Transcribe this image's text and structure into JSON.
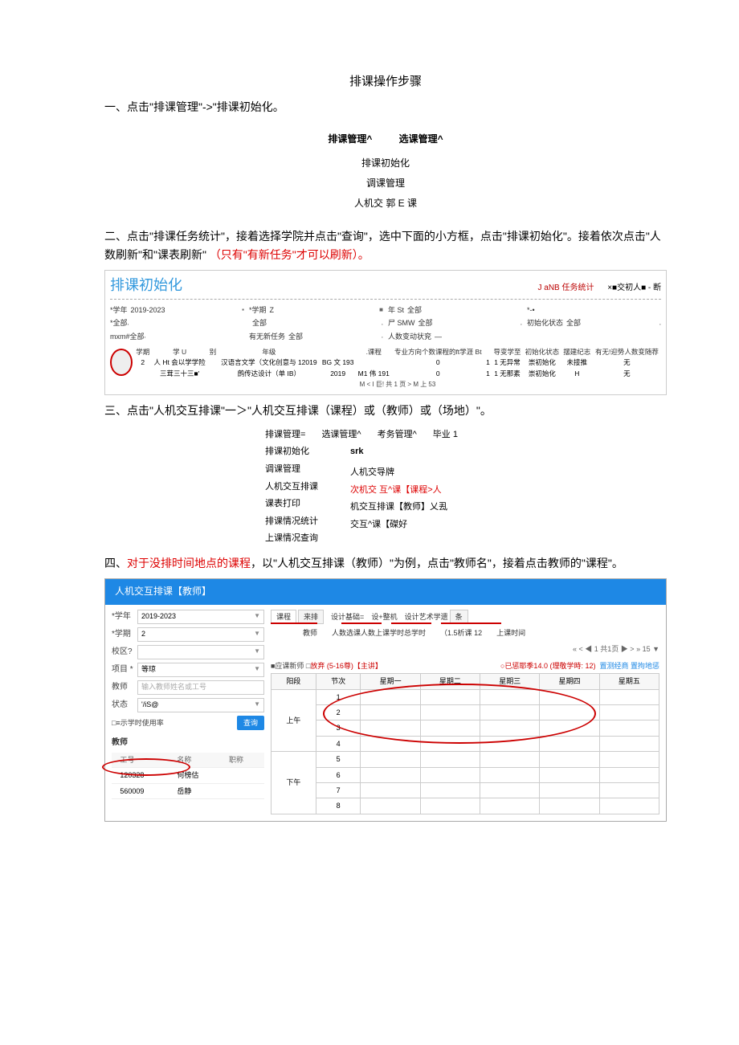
{
  "title": "排课操作步骤",
  "step1": "一、点击\"排课管理\"->\"排课初始化。",
  "menu1_top": [
    "排课管理^",
    "选课管理^"
  ],
  "menu1_items": [
    "排课初始化",
    "调课管理",
    "人机交 郭 E 课"
  ],
  "step2_a": "二、点击\"排课任务统计\"，接着选择学院并点击\"查询\"，选中下面的小方框，点击\"排课初始化\"。接着依次点击\"人数刷新\"和\"课表刷新\"",
  "step2_b": "（只有\"有新任务\"才可以刷新）。",
  "panel2": {
    "title": "排课初始化",
    "tabs": [
      "J aNB 任务统计",
      "×■交初人■ - 断"
    ],
    "filters": [
      [
        [
          "*学年",
          "2019-2023"
        ],
        [
          "*学期",
          "Z"
        ],
        [
          "年 St",
          "全部"
        ],
        [
          "*-•",
          ""
        ]
      ],
      [
        [
          "*全部",
          ""
        ],
        [
          "",
          "全部"
        ],
        [
          "尸 SMW",
          "全部"
        ],
        [
          "初始化状态",
          "全部"
        ]
      ],
      [
        [
          "mxm#全部",
          ""
        ],
        [
          "有无新任务",
          "全部"
        ],
        [
          "人数变动状兖",
          "—"
        ],
        [
          "",
          ""
        ]
      ]
    ],
    "th": [
      "学期",
      "学 U",
      "别",
      "年级",
      "",
      ".课程",
      "专业方向个数课程的ft学涯 Bt",
      "",
      "导变学至",
      "初始化状态",
      "摆建纪志",
      "有无!迎势人数变随荐"
    ],
    "r1": [
      "2",
      "人 Ht 会以学学险",
      "",
      "汉语言文学（文化创意与 12019",
      "BG 文 193",
      "",
      "0",
      "1",
      "1 无异常",
      "崇初始化",
      "未接推",
      "无"
    ],
    "r2": [
      "",
      "三茸三十三■'",
      "",
      "鹧传达设计（单 IB）",
      "2019",
      "M1 伟 191",
      "0",
      "1",
      "1 无那素",
      "崇初始化",
      "H",
      "无"
    ],
    "pager": "M < I 巨! 共 1 页 > M 上 53"
  },
  "step3": "三、点击\"人机交互排课\"一＞\"人机交互排课（课程）或（教师）或（场地）\"。",
  "menu3_top": [
    "排课管理=",
    "选课管理^",
    "考务管理^",
    "毕业 1"
  ],
  "menu3_left": [
    "排课初始化",
    "调课管理",
    "人机交互排课",
    "课表打印",
    "排课情况统计",
    "上课情况查询"
  ],
  "menu3_right": [
    "srk",
    "",
    "人机交导牌",
    "次机交 互^课【课程>人",
    "机交互排课【教师】乂厾",
    "交互^课【磔好"
  ],
  "step4_a": "四、",
  "step4_b": "对于没排时间地点的课程",
  "step4_c": "，以\"人机交互排课（教师）\"为例，点击\"教师名\"，接着点击教师的\"课程\"。",
  "shot": {
    "title": "人机交互排课【教师】",
    "left": {
      "xn_label": "*学年",
      "xn_val": "2019-2023",
      "xq_label": "*学期",
      "xq_val": "2",
      "xy_label": "校区?",
      "xy_val": "",
      "item_label": "项目 *",
      "item_val": "等琼",
      "teacher_label": "教师",
      "teacher_ph": "输入教师姓名或工号",
      "status_label": "状态",
      "status_val": "'/iS@",
      "chk": "□≡示学时使用率",
      "btn": "查询",
      "section": "教师",
      "th": [
        "",
        "工号",
        "名称",
        "职称"
      ],
      "rows": [
        [
          "",
          "120328",
          "何榜估",
          ""
        ],
        [
          "",
          "560009",
          "岳静",
          ""
        ]
      ]
    },
    "right": {
      "tabs_line_left": "课程",
      "tabs": [
        "来排",
        "设计基础=",
        "设+整机",
        "设计艺术学遗",
        "条"
      ],
      "info": [
        [
          "教师",
          ""
        ],
        [
          "人数选课人数上课学时总学时",
          ""
        ],
        [
          "（1.5析课",
          "12"
        ],
        [
          "上课时间",
          ""
        ]
      ],
      "pager": "« < ◀ 1 共1页 ▶ > » 15 ▼",
      "leg_left_a": "■应课新师 □",
      "leg_left_b": "放弃 (5-16尊)【主讲】",
      "leg_right": "○已惩耶季14.0 (理敬学時: 12)",
      "leg_links": "置测经商 置拘地惩",
      "sched_head": [
        "阳段",
        "节次",
        "星期一",
        "星期二",
        "星期三",
        "星期四",
        "星期五"
      ],
      "seg1": "上午",
      "seg1_rows": [
        "1",
        "2",
        "3",
        "4"
      ],
      "seg2": "下午",
      "seg2_rows": [
        "5",
        "6",
        "7",
        "8"
      ]
    }
  }
}
